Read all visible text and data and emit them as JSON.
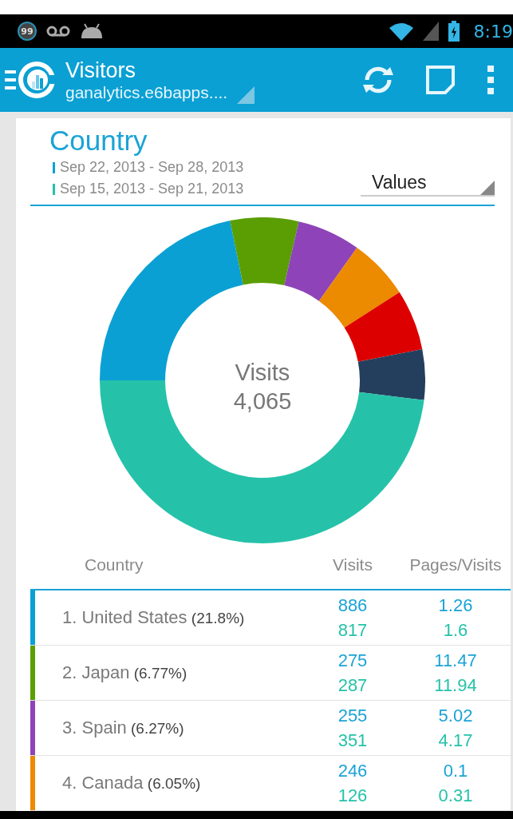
{
  "status_bar": {
    "badge": "99",
    "time": "8:19"
  },
  "action_bar": {
    "title": "Visitors",
    "subtitle": "ganalytics.e6bapps...."
  },
  "card": {
    "title": "Country",
    "date_ranges": [
      {
        "label": "Sep 22, 2013 - Sep 28, 2013",
        "color": "#0aa0d4"
      },
      {
        "label": "Sep 15, 2013 - Sep 21, 2013",
        "color": "#25c2a9"
      }
    ],
    "mode_select": {
      "value": "Values"
    },
    "donut": {
      "label": "Visits",
      "value": "4,065"
    },
    "table": {
      "columns": [
        "Country",
        "Visits",
        "Pages/Visits"
      ],
      "rows": [
        {
          "rank": "1.",
          "name": "United States",
          "share": "(21.8%)",
          "color": "#0aa0d4",
          "visits": [
            "886",
            "817"
          ],
          "pages": [
            "1.26",
            "1.6"
          ]
        },
        {
          "rank": "2.",
          "name": "Japan",
          "share": "(6.77%)",
          "color": "#5a9e04",
          "visits": [
            "275",
            "287"
          ],
          "pages": [
            "11.47",
            "11.94"
          ]
        },
        {
          "rank": "3.",
          "name": "Spain",
          "share": "(6.27%)",
          "color": "#8e44b8",
          "visits": [
            "255",
            "351"
          ],
          "pages": [
            "5.02",
            "4.17"
          ]
        },
        {
          "rank": "4.",
          "name": "Canada",
          "share": "(6.05%)",
          "color": "#ec8a00",
          "visits": [
            "246",
            "126"
          ],
          "pages": [
            "0.1",
            "0.31"
          ]
        }
      ]
    }
  }
}
